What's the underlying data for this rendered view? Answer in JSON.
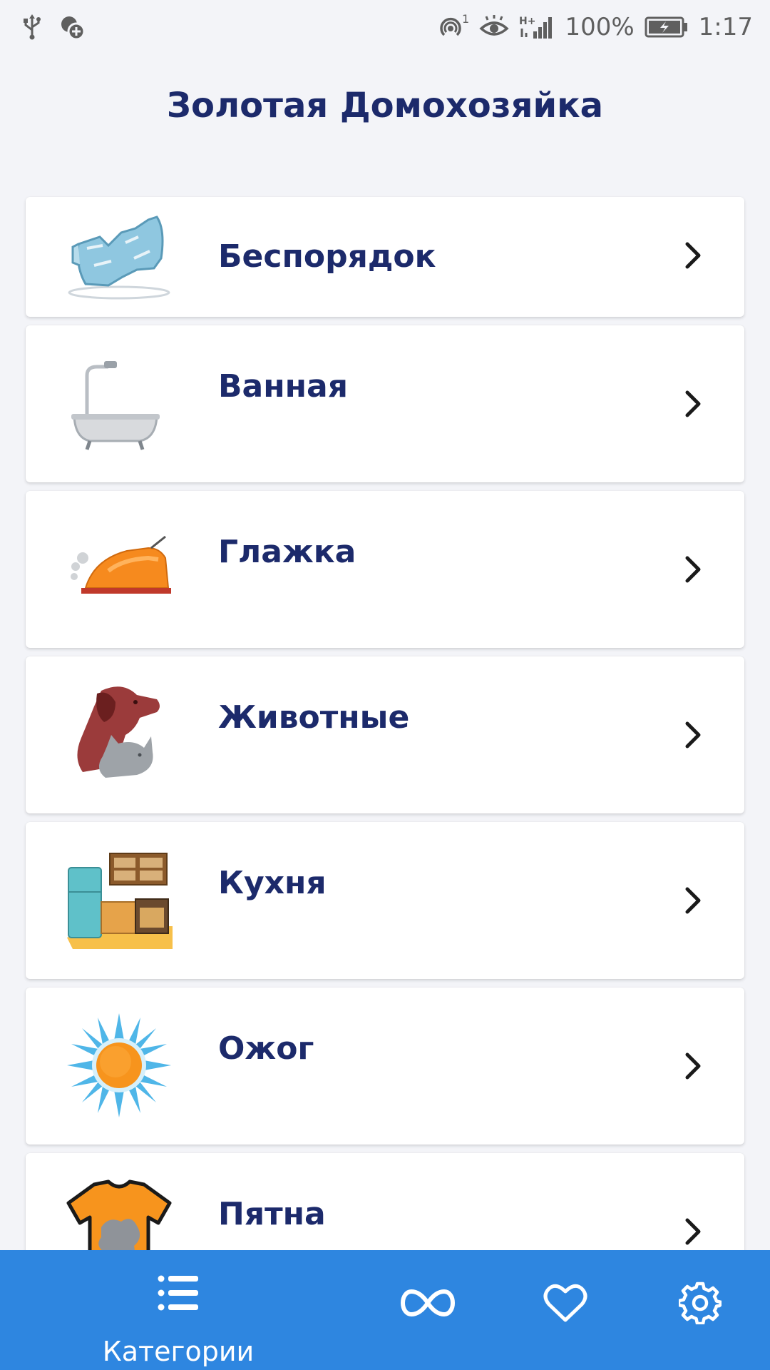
{
  "status_bar": {
    "battery": "100%",
    "time": "1:17",
    "icons": [
      "usb-icon",
      "add-circle-icon",
      "hotspot-icon",
      "eye-icon",
      "signal-icon",
      "battery-icon"
    ],
    "hotspot_count": "1"
  },
  "app": {
    "title": "Золотая Домохозяйка"
  },
  "categories": [
    {
      "label": "Беспорядок",
      "icon": "bottle-icon"
    },
    {
      "label": "Ванная",
      "icon": "bathtub-icon"
    },
    {
      "label": "Глажка",
      "icon": "iron-icon"
    },
    {
      "label": "Животные",
      "icon": "pets-icon"
    },
    {
      "label": "Кухня",
      "icon": "kitchen-icon"
    },
    {
      "label": "Ожог",
      "icon": "sun-icon"
    },
    {
      "label": "Пятна",
      "icon": "tshirt-stain-icon"
    }
  ],
  "bottom_nav": {
    "items": [
      {
        "label": "Категории",
        "icon": "list-icon",
        "active": true
      },
      {
        "label": "",
        "icon": "infinity-icon"
      },
      {
        "label": "",
        "icon": "heart-icon"
      },
      {
        "label": "",
        "icon": "gear-icon"
      }
    ]
  },
  "colors": {
    "background": "#f3f4f8",
    "title_text": "#1c2a6b",
    "nav_background": "#2e86e0",
    "card_background": "#ffffff"
  }
}
